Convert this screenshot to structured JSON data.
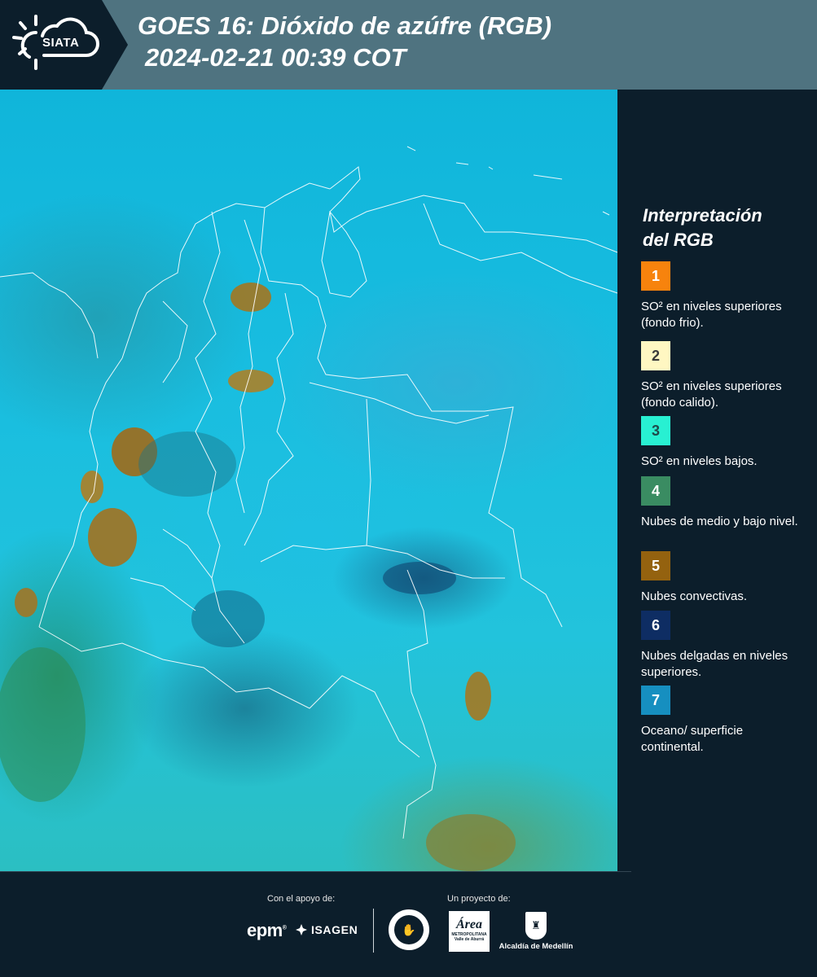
{
  "header": {
    "logo_text": "SIATA",
    "title_line1": "GOES 16: Dióxido de azúfre (RGB)",
    "title_line2": "2024-02-21 00:39 COT"
  },
  "legend": {
    "title_line1": "Interpretación",
    "title_line2": "del RGB",
    "items": [
      {
        "number": "1",
        "color": "#f7830d",
        "text_color": "#ffffff",
        "label": "SO² en niveles superiores (fondo frio)."
      },
      {
        "number": "2",
        "color": "#fff7c2",
        "text_color": "#3a3a3a",
        "label": "SO² en niveles superiores (fondo calido)."
      },
      {
        "number": "3",
        "color": "#28f0d2",
        "text_color": "#1f4a4a",
        "label": "SO² en niveles bajos."
      },
      {
        "number": "4",
        "color": "#3a8c62",
        "text_color": "#ffffff",
        "label": "Nubes de medio y bajo nivel."
      },
      {
        "number": "5",
        "color": "#94620f",
        "text_color": "#ffffff",
        "label": "Nubes convectivas."
      },
      {
        "number": "6",
        "color": "#0e2d63",
        "text_color": "#ffffff",
        "label": "Nubes delgadas en niveles superiores."
      },
      {
        "number": "7",
        "color": "#168fc0",
        "text_color": "#ffffff",
        "label": "Oceano/ superficie continental."
      }
    ]
  },
  "footer": {
    "support_label": "Con el apoyo de:",
    "project_label": "Un proyecto de:",
    "epm": "epm",
    "isagen": "ISAGEN",
    "area_word": "Área",
    "area_sub1": "METROPOLITANA",
    "area_sub2": "Valle de Aburrá",
    "alcaldia": "Alcaldía de Medellín"
  }
}
